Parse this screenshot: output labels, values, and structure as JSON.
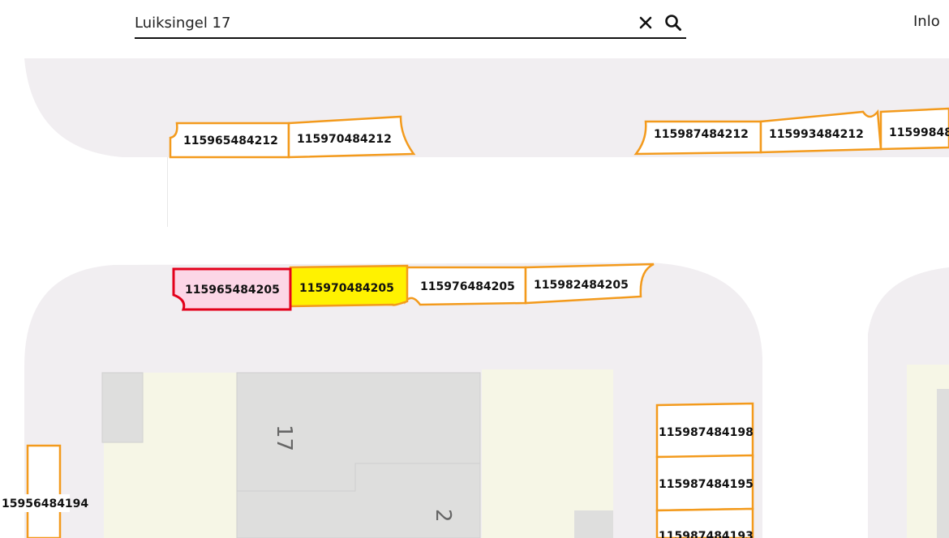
{
  "search": {
    "value": "Luiksingel 17",
    "clear_icon": "close-icon",
    "search_icon": "search-icon"
  },
  "header": {
    "login_label": "Inlo"
  },
  "map": {
    "parcels": {
      "top_left_1": "115965484212",
      "top_left_2": "115970484212",
      "top_right_1": "115987484212",
      "top_right_2": "115993484212",
      "top_right_3": "11599848",
      "mid_1": "115965484205",
      "mid_2": "115970484205",
      "mid_3": "115976484205",
      "mid_4": "115982484205",
      "right_col_1": "115987484198",
      "right_col_2": "115987484195",
      "right_col_3": "115987484193",
      "left_edge": "15956484194"
    },
    "buildings": {
      "house_17": "17",
      "house_2": "2"
    },
    "colors": {
      "road": "#f1eef1",
      "parcel_outline": "#f39a1c",
      "selected_outline": "#e3001b",
      "selected_fill": "#fcd6e6",
      "highlight_fill": "#fff200",
      "building": "#dededd",
      "plot": "#f6f6e6"
    }
  }
}
